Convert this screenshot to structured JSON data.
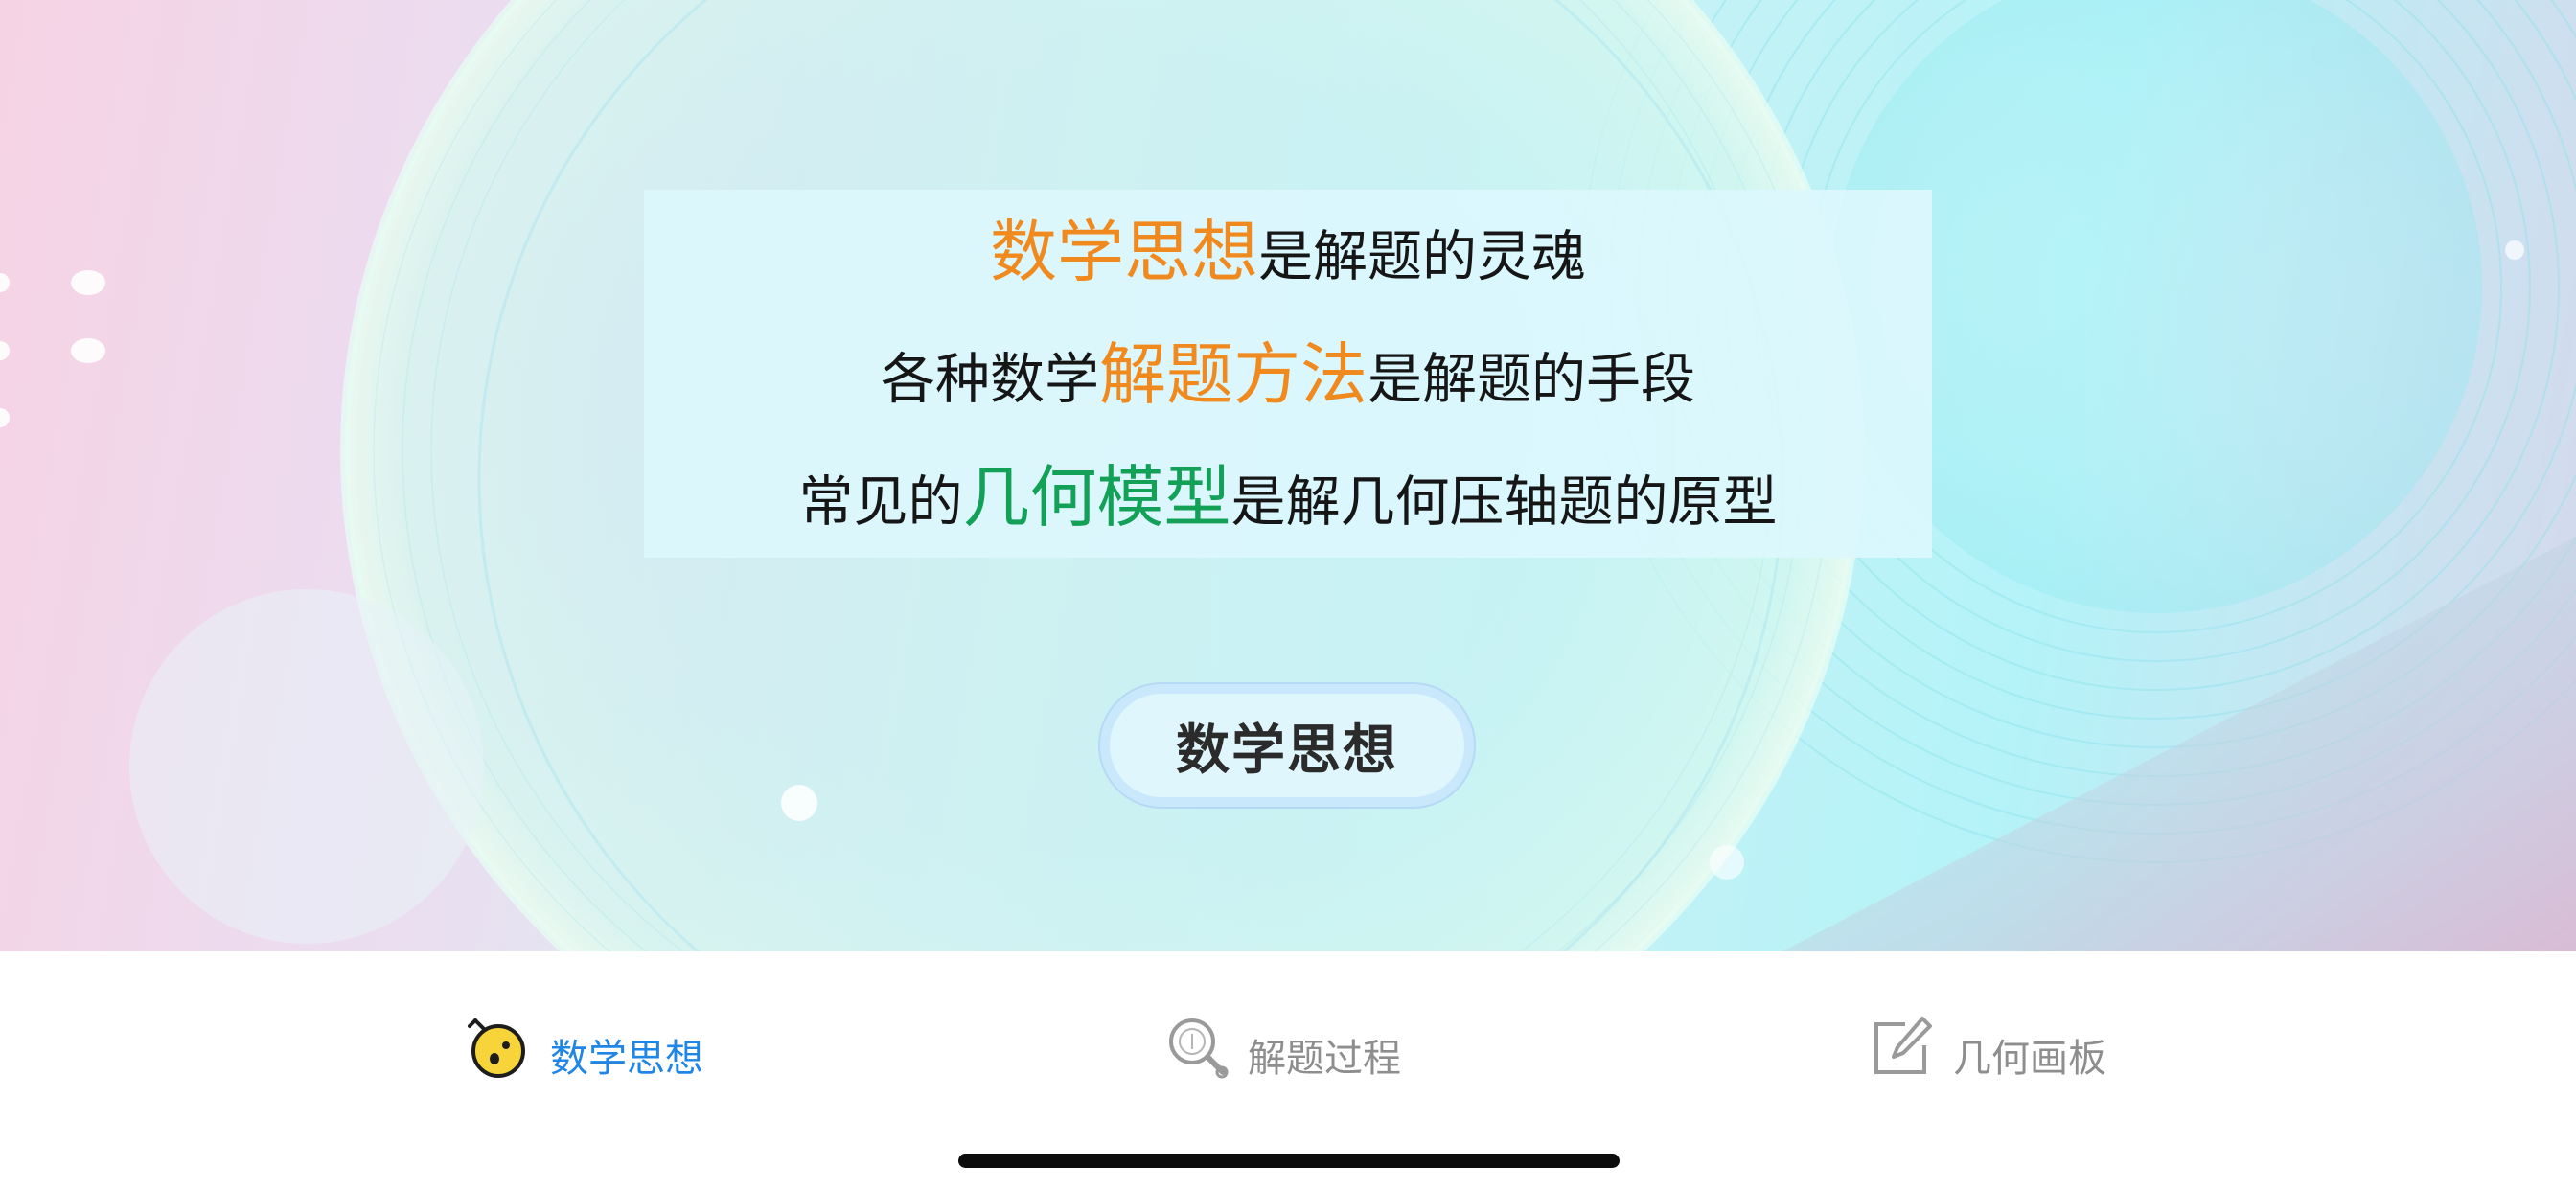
{
  "card": {
    "line1": {
      "highlight": "数学思想",
      "rest": "是解题的灵魂"
    },
    "line2": {
      "before": "各种数学",
      "highlight": "解题方法",
      "after": "是解题的手段"
    },
    "line3": {
      "before": "常见的",
      "highlight": "几何模型",
      "after": "是解几何压轴题的原型"
    }
  },
  "main_button": {
    "label": "数学思想"
  },
  "tabs": [
    {
      "label": "数学思想",
      "icon": "chick-icon",
      "active": true
    },
    {
      "label": "解题过程",
      "icon": "magnifier-icon",
      "active": false
    },
    {
      "label": "几何画板",
      "icon": "edit-icon",
      "active": false
    }
  ],
  "colors": {
    "orange_highlight": "#f08a1e",
    "green_highlight": "#13a057",
    "active_tab": "#1f86e6",
    "inactive_tab": "#8e8e8e"
  }
}
